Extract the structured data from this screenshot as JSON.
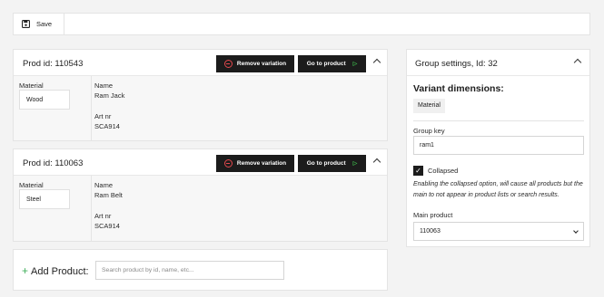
{
  "toolbar": {
    "save_label": "Save",
    "save_icon": "floppy-disk-icon"
  },
  "variations": [
    {
      "title": "Prod id: 110543",
      "remove_label": "Remove variation",
      "goto_label": "Go to product",
      "material_label": "Material",
      "material_value": "Wood",
      "name_label": "Name",
      "name_value": "Ram Jack",
      "artnr_label": "Art nr",
      "artnr_value": "SCA914"
    },
    {
      "title": "Prod id: 110063",
      "remove_label": "Remove variation",
      "goto_label": "Go to product",
      "material_label": "Material",
      "material_value": "Steel",
      "name_label": "Name",
      "name_value": "Ram Belt",
      "artnr_label": "Art nr",
      "artnr_value": "SCA914"
    }
  ],
  "add_product": {
    "plus": "+",
    "label": "Add Product:",
    "placeholder": "Search product by id, name, etc..."
  },
  "group_settings": {
    "title": "Group settings, Id: 32",
    "dimensions_label": "Variant dimensions:",
    "dimensions": [
      "Material"
    ],
    "group_key_label": "Group key",
    "group_key_value": "ram1",
    "collapsed_label": "Collapsed",
    "collapsed_checked": true,
    "help_text": "Enabling the collapsed option, will cause all products but the main to not appear in product lists or search results.",
    "main_product_label": "Main product",
    "main_product_value": "110063"
  },
  "colors": {
    "accent_dark": "#1c1c1c",
    "danger": "#e5484d",
    "success": "#3fbf4e"
  }
}
